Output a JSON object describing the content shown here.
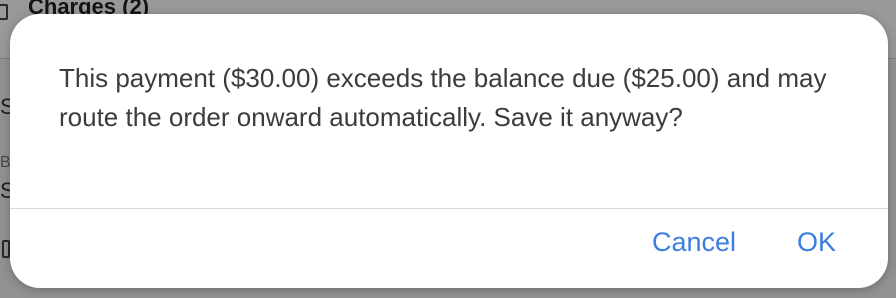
{
  "background": {
    "section_title": "Charges (2)",
    "partial_letter_1": "S",
    "partial_letter_2": "B",
    "partial_letter_3": "S"
  },
  "dialog": {
    "message": "This payment ($30.00) exceeds the balance due ($25.00) and may route the order onward automatically. Save it anyway?",
    "cancel_label": "Cancel",
    "ok_label": "OK"
  },
  "colors": {
    "accent": "#3b7de0",
    "message_text": "#3c3c3c",
    "divider": "#d8d8d8",
    "dialog_background": "#ffffff"
  }
}
